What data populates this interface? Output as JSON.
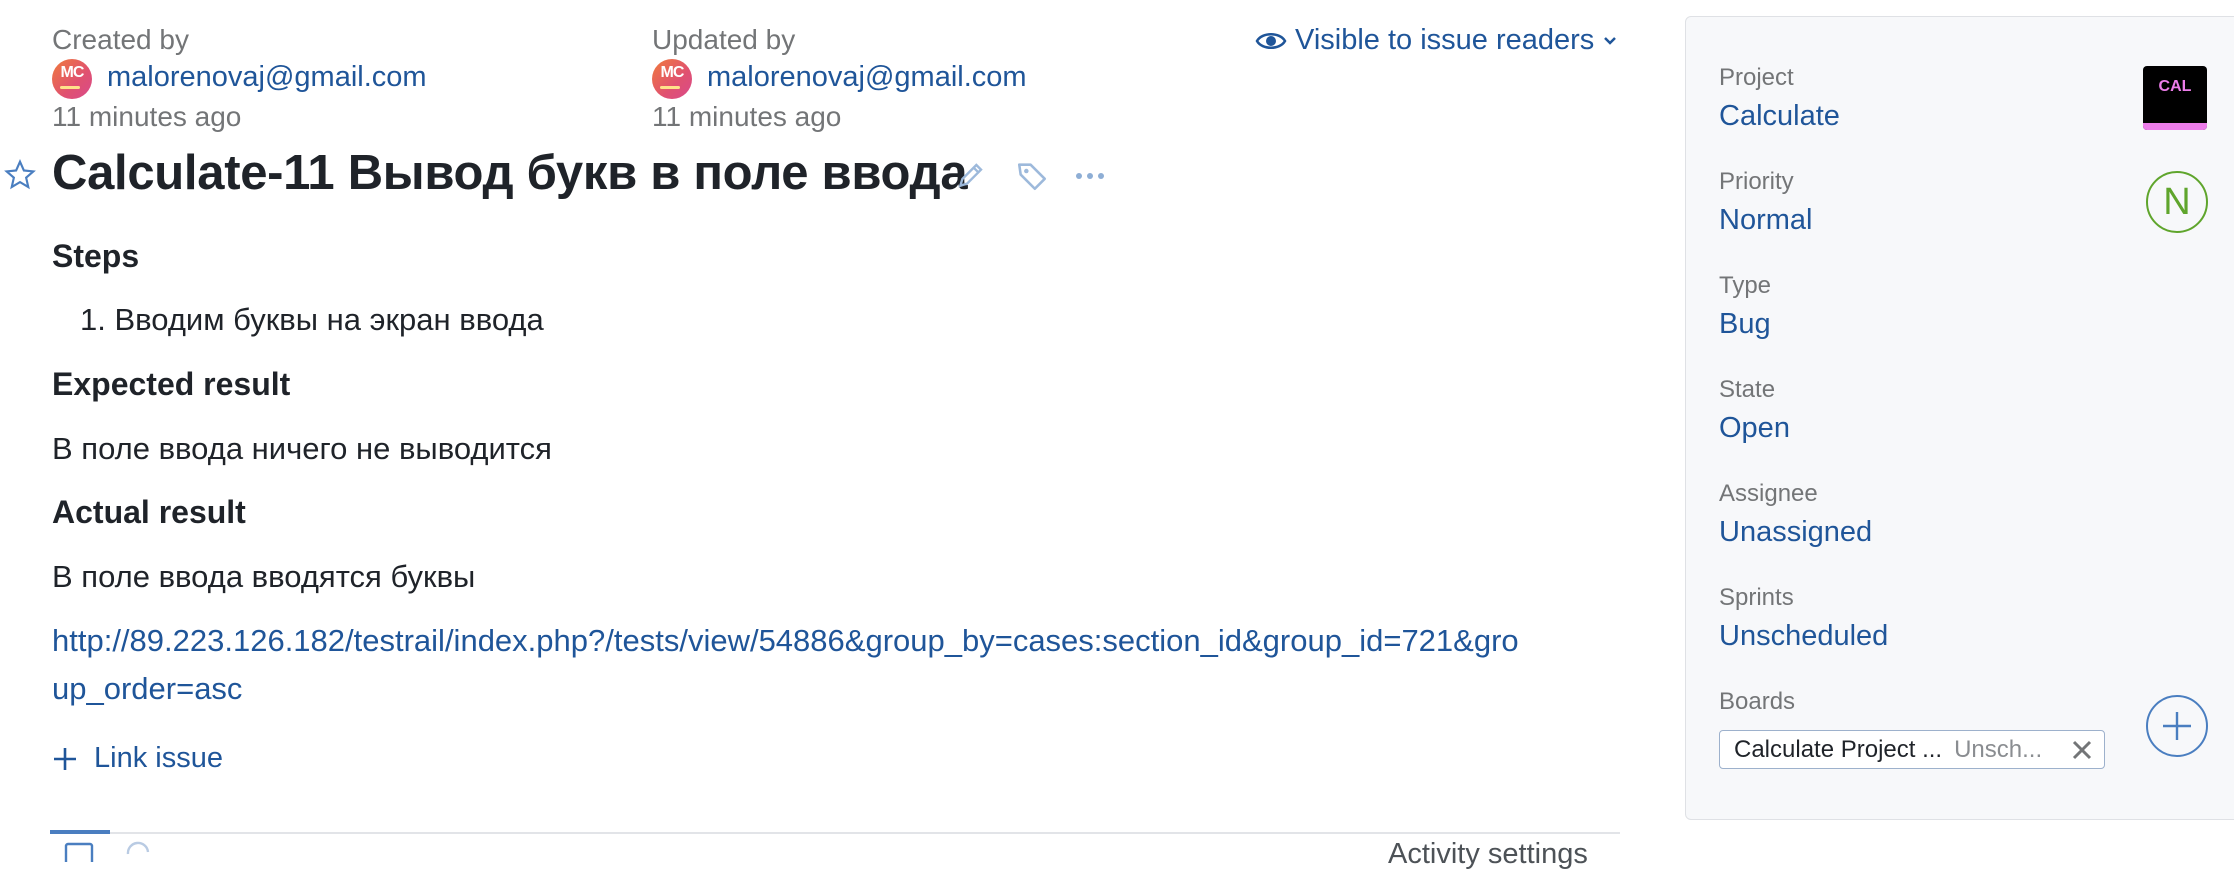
{
  "meta": {
    "created_by_label": "Created by",
    "created_by_user": "malorenovaj@gmail.com",
    "created_time": "11 minutes ago",
    "updated_by_label": "Updated by",
    "updated_by_user": "malorenovaj@gmail.com",
    "updated_time": "11 minutes ago",
    "avatar_initials": "MC",
    "visibility": "Visible to issue readers"
  },
  "issue": {
    "title": "Calculate-11 Вывод букв в поле ввода",
    "steps_heading": "Steps",
    "steps": [
      "Вводим буквы на экран ввода"
    ],
    "expected_heading": "Expected result",
    "expected_text": "В поле ввода ничего не выводится",
    "actual_heading": "Actual result",
    "actual_text": "В поле ввода вводятся буквы",
    "url_line1": "http://89.223.126.182/testrail/index.php?/tests/view/54886&group_by=cases:section_id&group_id=721&gro",
    "url_line2": "up_order=asc",
    "link_issue_label": "Link issue",
    "activity_settings_label": "Activity settings"
  },
  "sidebar": {
    "project_label": "Project",
    "project_value": "Calculate",
    "project_logo_text": "CAL",
    "priority_label": "Priority",
    "priority_value": "Normal",
    "priority_badge": "N",
    "type_label": "Type",
    "type_value": "Bug",
    "state_label": "State",
    "state_value": "Open",
    "assignee_label": "Assignee",
    "assignee_value": "Unassigned",
    "sprints_label": "Sprints",
    "sprints_value": "Unscheduled",
    "boards_label": "Boards",
    "board_chip_name": "Calculate Project ...",
    "board_chip_sched": "Unsch..."
  },
  "colors": {
    "link": "#1f5599",
    "priority_green": "#5fa52c",
    "project_logo_bg": "#000000",
    "project_logo_accent": "#ec7de9"
  },
  "icons": [
    "star-icon",
    "pencil-icon",
    "tag-icon",
    "more-icon",
    "eye-icon",
    "chevron-down-icon",
    "plus-icon",
    "close-icon",
    "circle-plus-icon"
  ]
}
